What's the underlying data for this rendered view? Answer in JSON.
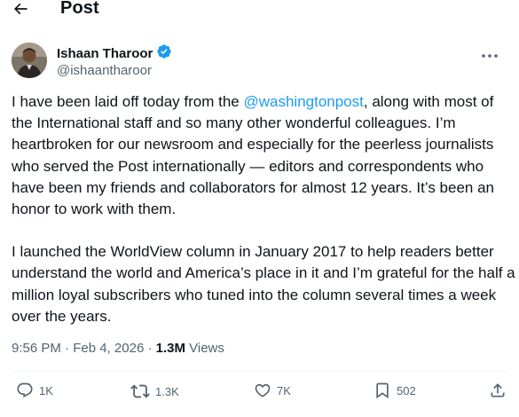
{
  "header": {
    "title": "Post",
    "back_icon": "back-arrow-icon"
  },
  "author": {
    "name": "Ishaan Tharoor",
    "handle": "@ishaantharoor",
    "verified_icon": "verified-badge-icon",
    "verified_color": "#1d9bf0"
  },
  "tweet": {
    "p1_before": "I have been laid off today from the ",
    "mention": "@washingtonpost",
    "p1_after": ", along with most of the International staff and so many other wonderful colleagues. I’m heartbroken for our newsroom and especially for the peerless journalists who served the Post internationally — editors and correspondents who have been my friends and collaborators for almost 12 years. It’s been an honor to work with them.",
    "p2": "I launched the WorldView column in January 2017 to help readers better understand the world and America’s place in it and I’m grateful for the half a million loyal subscribers who tuned into the column several times a week over the years."
  },
  "meta": {
    "time": "9:56 PM",
    "sep1": " · ",
    "date": "Feb 4, 2026",
    "sep2": " · ",
    "views_count": "1.3M",
    "views_label": " Views"
  },
  "actions": {
    "replies": "1K",
    "reposts": "1.3K",
    "likes": "7K",
    "bookmarks": "502"
  },
  "colors": {
    "text": "#0f1419",
    "secondary": "#536471",
    "link": "#1d9bf0",
    "divider": "#eff3f4"
  }
}
